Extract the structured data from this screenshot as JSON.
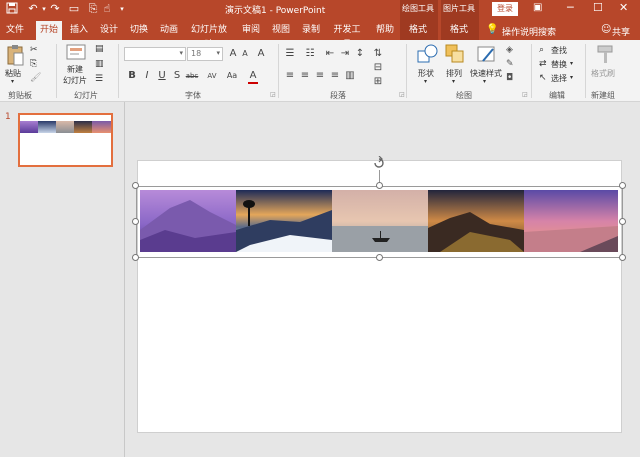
{
  "titlebar": {
    "doc_title": "演示文稿1 - PowerPoint",
    "context_drawing": "绘图工具",
    "context_picture": "图片工具",
    "login": "登录"
  },
  "tabs": [
    "文件",
    "开始",
    "插入",
    "设计",
    "切换",
    "动画",
    "幻灯片放映",
    "审阅",
    "视图",
    "录制",
    "开发工具",
    "帮助",
    "格式",
    "格式"
  ],
  "active_tab": "开始",
  "tell_me": "操作说明搜索",
  "share": "共享",
  "ribbon": {
    "clipboard": {
      "paste": "粘贴",
      "group": "剪贴板"
    },
    "slides": {
      "new_slide_line1": "新建",
      "new_slide_line2": "幻灯片",
      "group": "幻灯片"
    },
    "font": {
      "font_name": "",
      "font_size": "18",
      "group": "字体"
    },
    "paragraph": {
      "group": "段落"
    },
    "drawing": {
      "shapes": "形状",
      "arrange": "排列",
      "quick_styles": "快速样式",
      "group": "绘图"
    },
    "editing": {
      "find": "查找",
      "replace": "替换",
      "select": "选择",
      "group": "编辑"
    },
    "newgroup": {
      "format_painter": "格式刷",
      "group": "新建组"
    }
  },
  "thumbnail": {
    "number": "1"
  },
  "colors": {
    "accent": "#b7472a",
    "context_band": "#9f3a21",
    "ribbon_bg": "#f3f3f3",
    "workspace": "#e6e6e6",
    "selection": "#e36f3e"
  }
}
